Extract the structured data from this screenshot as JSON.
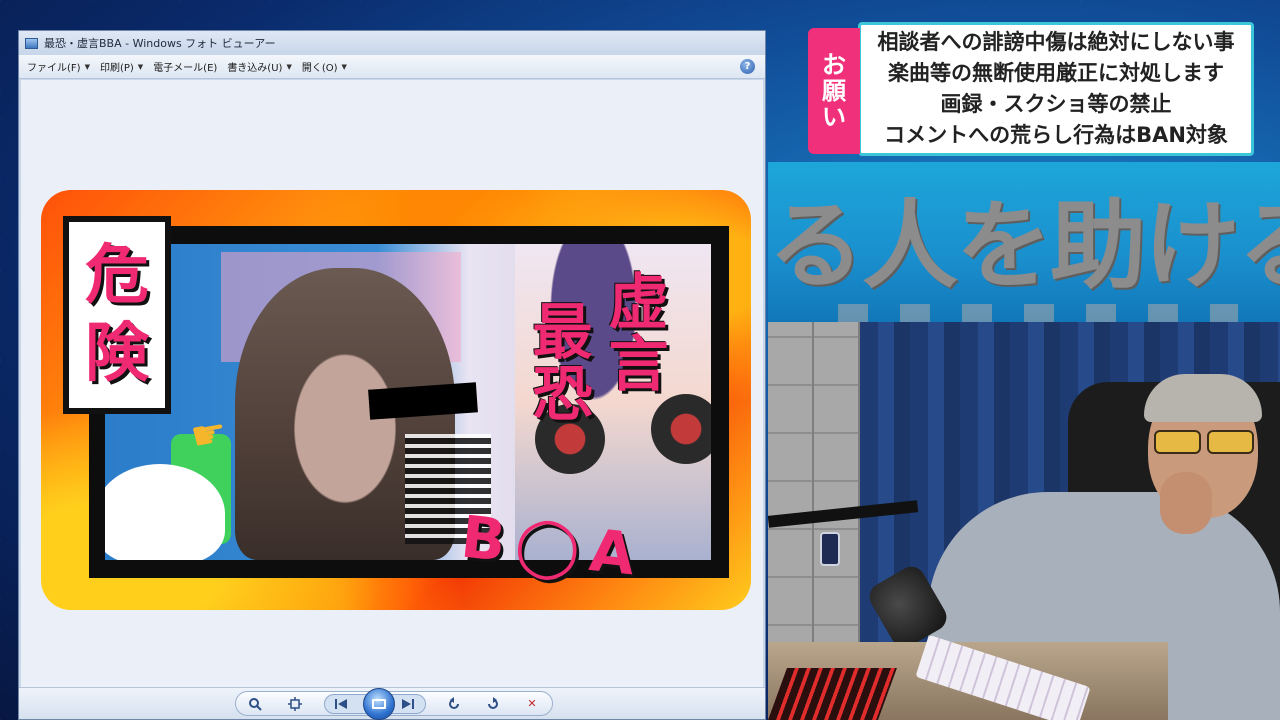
{
  "viewer": {
    "title": "最恐・虚言BBA - Windows フォト ビューアー",
    "menu": [
      {
        "label": "ファイル(F)"
      },
      {
        "label": "印刷(P)"
      },
      {
        "label": "電子メール(E)"
      },
      {
        "label": "書き込み(U)"
      },
      {
        "label": "開く(O)"
      }
    ],
    "help_symbol": "?",
    "toolbar": {
      "zoom_icon": "magnifier-icon",
      "fit_icon": "actual-size-icon",
      "prev_icon": "previous-icon",
      "slideshow_icon": "slideshow-icon",
      "next_icon": "next-icon",
      "rotate_left_icon": "rotate-ccw-icon",
      "rotate_right_icon": "rotate-cw-icon",
      "delete_icon": "delete-icon",
      "delete_symbol": "✕"
    }
  },
  "thumbnail": {
    "danger_chars": [
      "危",
      "険"
    ],
    "vertical_left": "最恐",
    "vertical_right": "虚言",
    "bba_text": "B◯A",
    "accent_color": "#f02a72"
  },
  "notice": {
    "tag_chars": [
      "お",
      "願",
      "い"
    ],
    "lines": [
      "相談者への誹謗中傷は絶対にしない事",
      "楽曲等の無断使用厳正に対処します",
      "画録・スクショ等の禁止",
      "コメントへの荒らし行為はBAN対象"
    ],
    "tag_color": "#f0307a",
    "border_color": "#3cc7d8"
  },
  "banner": {
    "text": "る人を助ける"
  }
}
